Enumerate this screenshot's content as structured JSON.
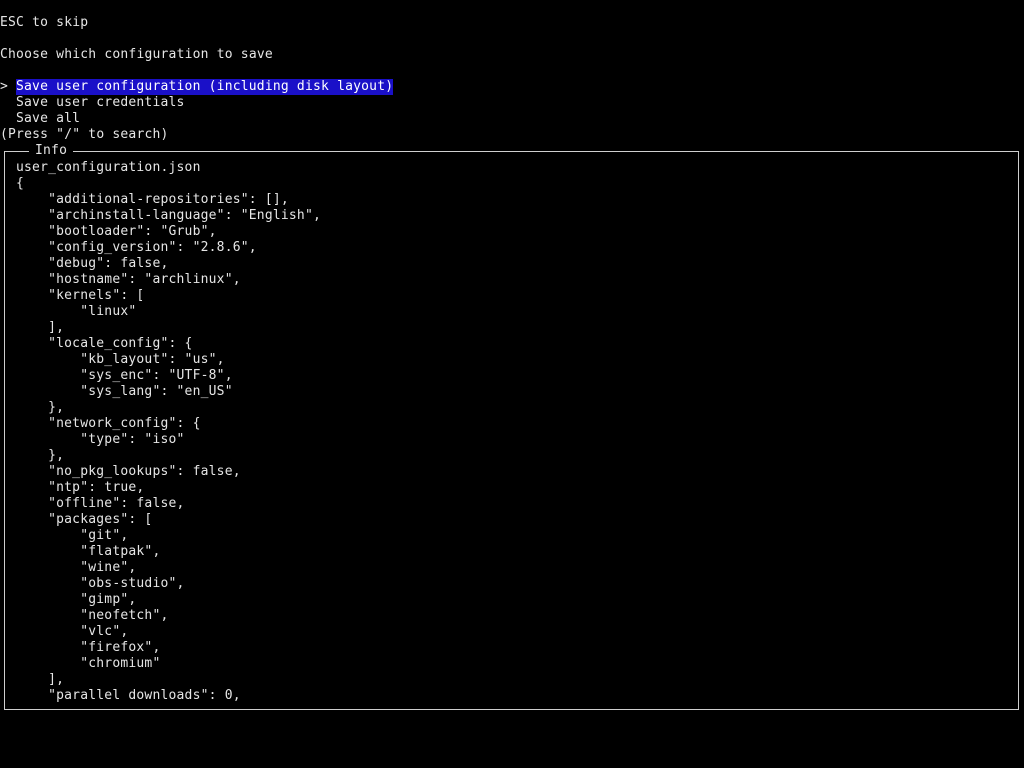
{
  "header": {
    "esc_hint": "ESC to skip",
    "prompt_title": "Choose which configuration to save"
  },
  "menu": {
    "cursor_glyph": ">",
    "items": [
      {
        "label": "Save user configuration (including disk layout)",
        "selected": true
      },
      {
        "label": "Save user credentials",
        "selected": false
      },
      {
        "label": "Save all",
        "selected": false
      }
    ],
    "search_hint": "(Press \"/\" to search)"
  },
  "info_panel": {
    "title": "Info",
    "filename": "user_configuration.json",
    "code_lines": [
      "{",
      "    \"additional-repositories\": [],",
      "    \"archinstall-language\": \"English\",",
      "    \"bootloader\": \"Grub\",",
      "    \"config_version\": \"2.8.6\",",
      "    \"debug\": false,",
      "    \"hostname\": \"archlinux\",",
      "    \"kernels\": [",
      "        \"linux\"",
      "    ],",
      "    \"locale_config\": {",
      "        \"kb_layout\": \"us\",",
      "        \"sys_enc\": \"UTF-8\",",
      "        \"sys_lang\": \"en_US\"",
      "    },",
      "    \"network_config\": {",
      "        \"type\": \"iso\"",
      "    },",
      "    \"no_pkg_lookups\": false,",
      "    \"ntp\": true,",
      "    \"offline\": false,",
      "    \"packages\": [",
      "        \"git\",",
      "        \"flatpak\",",
      "        \"wine\",",
      "        \"obs-studio\",",
      "        \"gimp\",",
      "        \"neofetch\",",
      "        \"vlc\",",
      "        \"firefox\",",
      "        \"chromium\"",
      "    ],",
      "    \"parallel downloads\": 0,"
    ]
  },
  "colors": {
    "background": "#000000",
    "foreground": "#e6e6e6",
    "selection_background": "#1a10c8",
    "border": "#cfcfcf"
  }
}
